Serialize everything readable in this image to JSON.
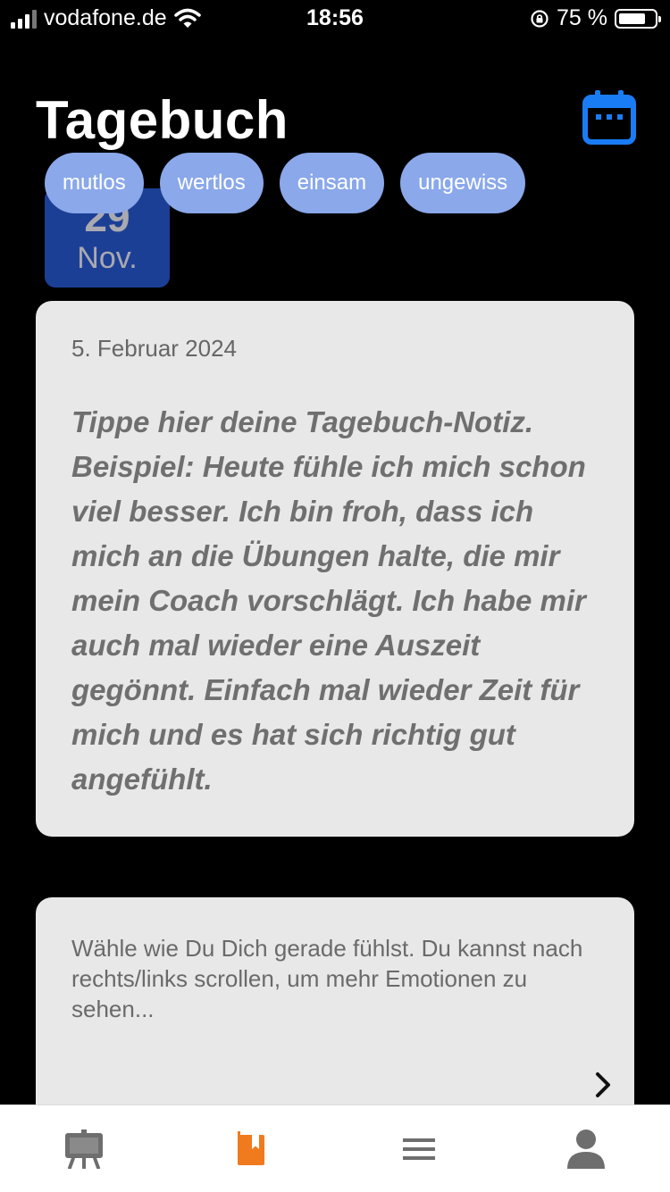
{
  "status_bar": {
    "carrier": "vodafone.de",
    "time": "18:56",
    "battery": "75 %",
    "battery_level": 0.75,
    "signal_bars": 3,
    "signal_bars_total": 4
  },
  "header": {
    "title": "Tagebuch",
    "calendar_icon": "calendar-icon",
    "accent_color": "#1a7cf5"
  },
  "date_chip": {
    "day": "29",
    "month": "Nov.",
    "color": "#1c3f96"
  },
  "note": {
    "date": "5. Februar 2024",
    "placeholder": "Tippe hier deine Tagebuch-Notiz. Beispiel: Heute fühle ich mich schon viel besser. Ich bin froh, dass ich mich an die Übungen halte, die mir mein Coach vorschlägt. Ich habe mir auch mal wieder eine Auszeit gegönnt. Einfach mal wieder Zeit für mich und es hat sich richtig gut angefühlt."
  },
  "emotions": {
    "hint": "Wähle wie Du Dich gerade fühlst. Du kannst nach rechts/links scrollen, um mehr Emotionen zu sehen...",
    "chips": [
      "mutlos",
      "wertlos",
      "einsam",
      "ungewiss"
    ],
    "chip_color": "#8aa8ea",
    "next_icon": "chevron-right-icon"
  },
  "tab_bar": {
    "tabs": [
      {
        "icon": "easel-icon",
        "active": false
      },
      {
        "icon": "journal-icon",
        "active": true,
        "color": "#f07a1e"
      },
      {
        "icon": "menu-icon",
        "active": false
      },
      {
        "icon": "profile-icon",
        "active": false
      }
    ]
  }
}
